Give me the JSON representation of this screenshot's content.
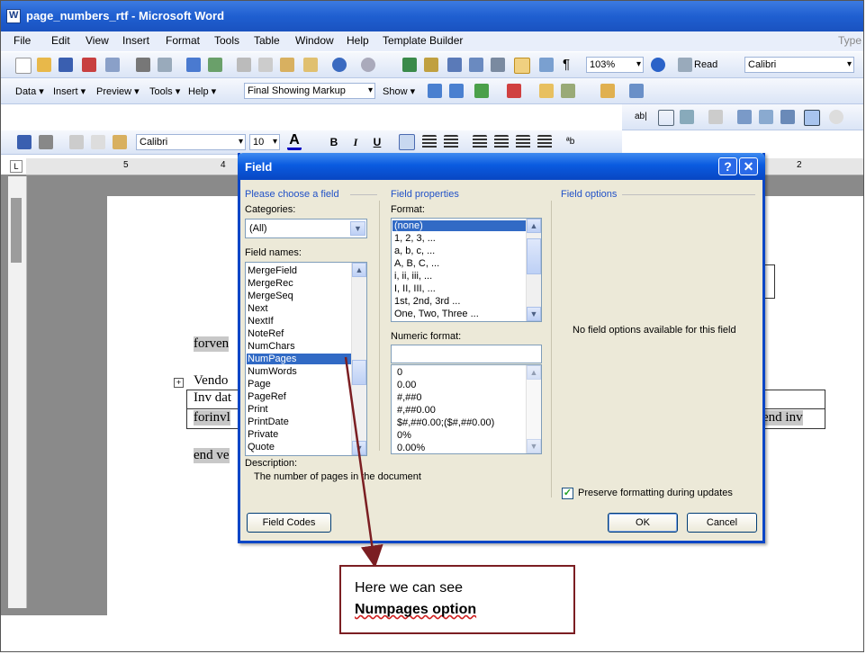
{
  "window": {
    "title": "page_numbers_rtf - Microsoft Word"
  },
  "menu": {
    "items": [
      "File",
      "Edit",
      "View",
      "Insert",
      "Format",
      "Tools",
      "Table",
      "Window",
      "Help",
      "Template Builder"
    ],
    "type_hint": "Type"
  },
  "toolbar1": {
    "zoom": "103%",
    "read": "Read",
    "font": "Calibri"
  },
  "toolbar2": {
    "data": "Data ▾",
    "insert": "Insert ▾",
    "preview": "Preview ▾",
    "tools": "Tools ▾",
    "help": "Help ▾",
    "markup": "Final Showing Markup",
    "show": "Show ▾"
  },
  "toolbar4": {
    "font": "Calibri",
    "size": "10"
  },
  "ruler": {
    "left": "5",
    "mid": "4",
    "right": "2"
  },
  "document": {
    "line1": "forven",
    "line2": "Vendo",
    "line3": "Inv dat",
    "line4": "forinvl",
    "line5": "end inv",
    "line6": "end ve"
  },
  "dialog": {
    "title": "Field",
    "help": "?",
    "close": "✕",
    "choose_group": "Please choose a field",
    "categories_label": "Categories:",
    "categories_value": "(All)",
    "field_names_label": "Field names:",
    "field_names": [
      "MergeField",
      "MergeRec",
      "MergeSeq",
      "Next",
      "NextIf",
      "NoteRef",
      "NumChars",
      "NumPages",
      "NumWords",
      "Page",
      "PageRef",
      "Print",
      "PrintDate",
      "Private",
      "Quote"
    ],
    "props_group": "Field properties",
    "format_label": "Format:",
    "formats": [
      "(none)",
      "1, 2, 3, ...",
      "a, b, c, ...",
      "A, B, C, ...",
      "i, ii, iii, ...",
      "I, II, III, ...",
      "1st, 2nd, 3rd ...",
      "One, Two, Three ..."
    ],
    "numeric_label": "Numeric format:",
    "numeric_value": "",
    "numeric_formats": [
      "0",
      "0.00",
      "#,##0",
      "#,##0.00",
      "$#,##0.00;($#,##0.00)",
      "0%",
      "0.00%"
    ],
    "options_group": "Field options",
    "no_options": "No field options available for this field",
    "description_label": "Description:",
    "description": "The number of pages in the document",
    "preserve": "Preserve formatting during updates",
    "field_codes": "Field Codes",
    "ok": "OK",
    "cancel": "Cancel"
  },
  "callout": {
    "line1": "Here we can see",
    "line2": "Numpages option"
  }
}
